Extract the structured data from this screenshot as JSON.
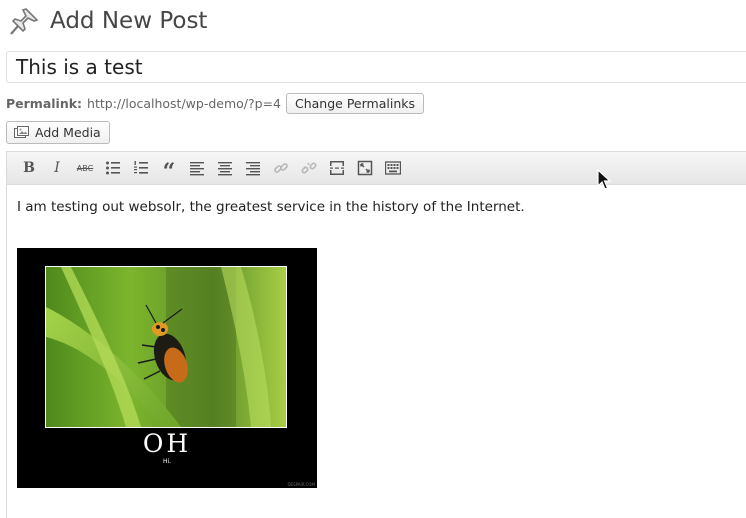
{
  "page": {
    "heading": "Add New Post",
    "icon": "pushpin-icon"
  },
  "title_field": {
    "value": "This is a test"
  },
  "permalink": {
    "label": "Permalink:",
    "url": "http://localhost/wp-demo/?p=4",
    "change_button": "Change Permalinks"
  },
  "add_media": {
    "label": "Add Media",
    "icon": "media-icon"
  },
  "toolbar": {
    "buttons": [
      {
        "name": "bold",
        "glyph": "B"
      },
      {
        "name": "italic",
        "glyph": "I"
      },
      {
        "name": "strikethrough",
        "glyph": "ABC"
      },
      {
        "name": "bullet-list",
        "icon": "bullet-list-icon"
      },
      {
        "name": "numbered-list",
        "icon": "numbered-list-icon"
      },
      {
        "name": "blockquote",
        "glyph": "“"
      },
      {
        "name": "align-left",
        "icon": "align-left-icon"
      },
      {
        "name": "align-center",
        "icon": "align-center-icon"
      },
      {
        "name": "align-right",
        "icon": "align-right-icon"
      },
      {
        "name": "insert-link",
        "icon": "link-icon",
        "disabled": true
      },
      {
        "name": "remove-link",
        "icon": "unlink-icon",
        "disabled": true
      },
      {
        "name": "read-more",
        "icon": "more-tag-icon"
      },
      {
        "name": "fullscreen",
        "icon": "fullscreen-icon"
      },
      {
        "name": "kitchen-sink",
        "icon": "keyboard-icon"
      }
    ]
  },
  "content": {
    "paragraph": "I am testing  out websolr, the greatest service in the history of the Internet.",
    "image": {
      "title": "OH",
      "subtitle": "Hi.",
      "credit": "DESPAIR.COM"
    }
  },
  "colors": {
    "accent_button_border": "#bbbbbb",
    "toolbar_bg": "#efefef",
    "poster_bg": "#000000"
  }
}
